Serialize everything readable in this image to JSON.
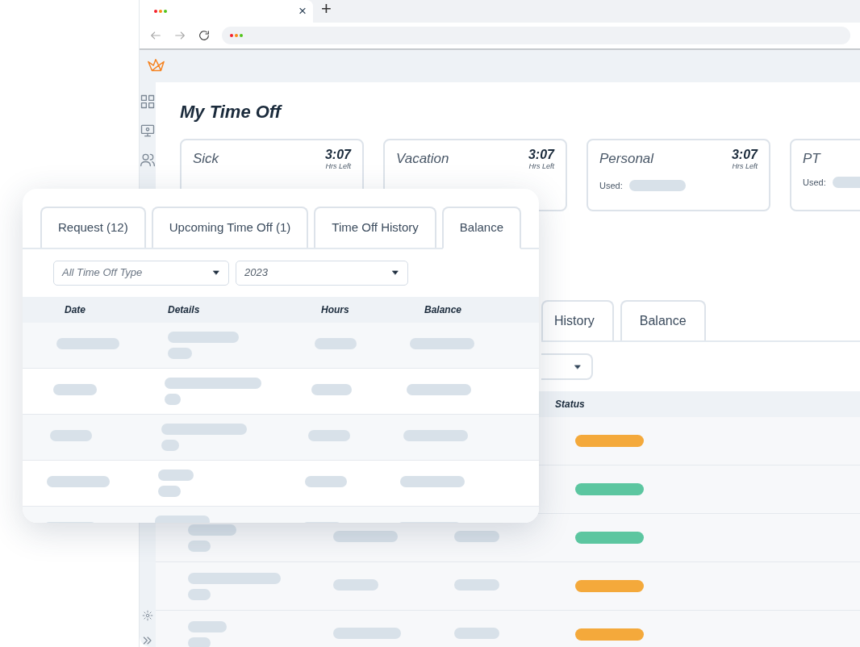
{
  "browser": {
    "tab_close": "×",
    "new_tab": "+"
  },
  "page_title": "My Time Off",
  "balance_cards": [
    {
      "type": "Sick",
      "value": "3:07",
      "unit": "Hrs Left"
    },
    {
      "type": "Vacation",
      "value": "3:07",
      "unit": "Hrs Left"
    },
    {
      "type": "Personal",
      "value": "3:07",
      "unit": "Hrs Left",
      "used_label": "Used:"
    },
    {
      "type": "PT",
      "used_label": "Used:"
    }
  ],
  "back_tabs": [
    {
      "label": "History",
      "selected": false
    },
    {
      "label": "Balance",
      "selected": false
    }
  ],
  "back_table": {
    "columns": [
      "Status"
    ],
    "rows": [
      {
        "kind": "status",
        "color": "#f4a93b"
      },
      {
        "kind": "status",
        "color": "#5cc6a0"
      },
      {
        "kind": "skeleton",
        "color": "#5cc6a0"
      },
      {
        "kind": "skeleton",
        "color": "#f4a93b"
      },
      {
        "kind": "skeleton",
        "color": "#f4a93b"
      }
    ]
  },
  "front_card": {
    "tabs": [
      {
        "label": "Request (12)",
        "selected": false
      },
      {
        "label": "Upcoming Time Off (1)",
        "selected": false
      },
      {
        "label": "Time Off History",
        "selected": false
      },
      {
        "label": "Balance",
        "selected": true
      }
    ],
    "filters": [
      {
        "placeholder": "All Time Off Type"
      },
      {
        "value": "2023"
      }
    ],
    "columns": [
      "Date",
      "Details",
      "Hours",
      "Balance"
    ],
    "rows": [
      {
        "kind": "skeleton"
      },
      {
        "kind": "skeleton"
      },
      {
        "kind": "skeleton"
      },
      {
        "kind": "skeleton"
      },
      {
        "kind": "skeleton"
      }
    ]
  }
}
